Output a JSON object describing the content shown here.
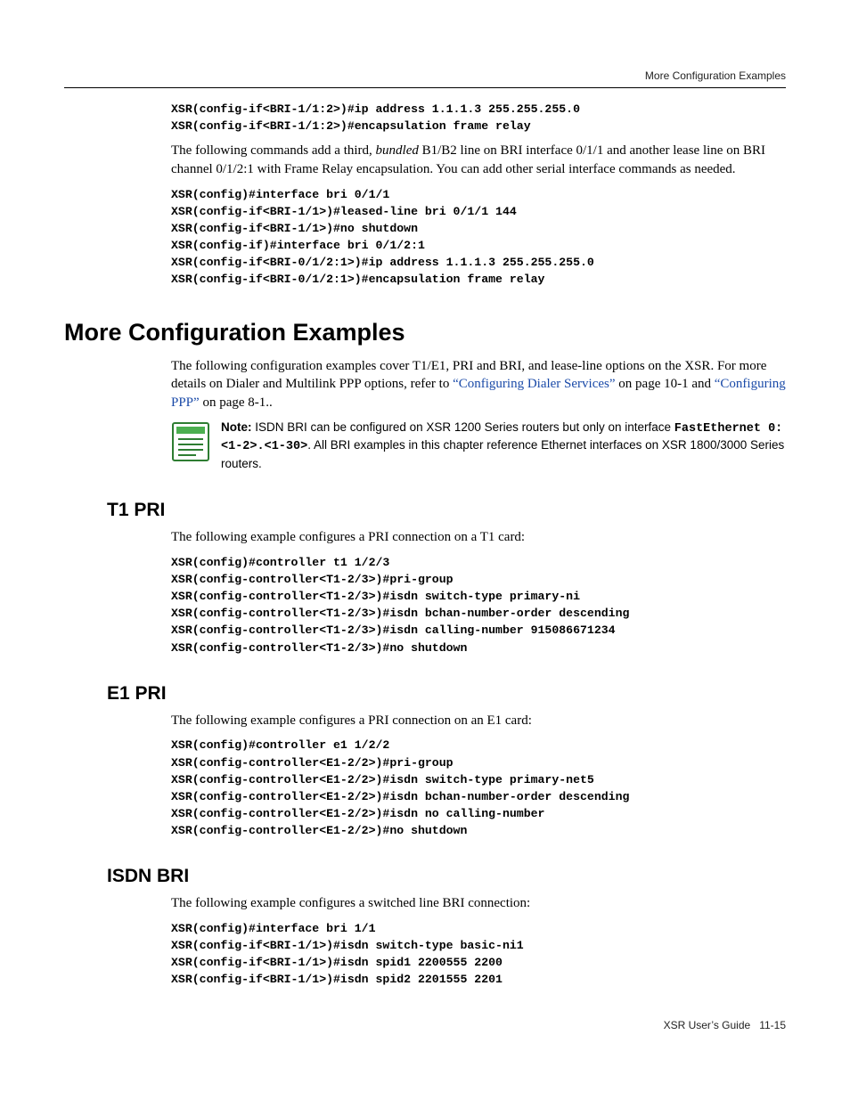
{
  "header": {
    "right": "More Configuration Examples"
  },
  "intro": {
    "code_top": "XSR(config-if<BRI-1/1:2>)#ip address 1.1.1.3 255.255.255.0\nXSR(config-if<BRI-1/1:2>)#encapsulation frame relay",
    "para1_pre": "The following commands add a third, ",
    "para1_italic": "bundled",
    "para1_post": " B1/B2 line on BRI interface 0/1/1 and another lease line on BRI channel 0/1/2:1 with Frame Relay encapsulation. You can add other serial interface commands as needed.",
    "code_block": "XSR(config)#interface bri 0/1/1\nXSR(config-if<BRI-1/1>)#leased-line bri 0/1/1 144\nXSR(config-if<BRI-1/1>)#no shutdown\nXSR(config-if)#interface bri 0/1/2:1\nXSR(config-if<BRI-0/1/2:1>)#ip address 1.1.1.3 255.255.255.0\nXSR(config-if<BRI-0/1/2:1>)#encapsulation frame relay"
  },
  "section_more": {
    "heading": "More Configuration Examples",
    "para_pre": "The following configuration examples cover T1/E1, PRI and BRI, and lease-line options on the XSR. For more details on Dialer and Multilink PPP options, refer to ",
    "link1": "“Configuring Dialer Services”",
    "para_mid": " on page 10-1 and ",
    "link2": "“Configuring PPP”",
    "para_post": " on page 8-1..",
    "note_label": "Note:",
    "note_text1": " ISDN BRI can be configured on XSR 1200 Series routers but only on interface ",
    "note_mono": "FastEthernet 0:<1-2>.<1-30>",
    "note_text2": ". All BRI examples in this chapter reference Ethernet interfaces on XSR 1800/3000 Series routers."
  },
  "t1pri": {
    "heading": "T1 PRI",
    "para": "The following example configures a PRI connection on a T1 card:",
    "code": "XSR(config)#controller t1 1/2/3\nXSR(config-controller<T1-2/3>)#pri-group\nXSR(config-controller<T1-2/3>)#isdn switch-type primary-ni\nXSR(config-controller<T1-2/3>)#isdn bchan-number-order descending\nXSR(config-controller<T1-2/3>)#isdn calling-number 915086671234\nXSR(config-controller<T1-2/3>)#no shutdown"
  },
  "e1pri": {
    "heading": "E1 PRI",
    "para": "The following example configures a PRI connection on an E1 card:",
    "code": "XSR(config)#controller e1 1/2/2\nXSR(config-controller<E1-2/2>)#pri-group\nXSR(config-controller<E1-2/2>)#isdn switch-type primary-net5\nXSR(config-controller<E1-2/2>)#isdn bchan-number-order descending\nXSR(config-controller<E1-2/2>)#isdn no calling-number\nXSR(config-controller<E1-2/2>)#no shutdown"
  },
  "isdnbri": {
    "heading": "ISDN BRI",
    "para": "The following example configures a switched line BRI connection:",
    "code": "XSR(config)#interface bri 1/1\nXSR(config-if<BRI-1/1>)#isdn switch-type basic-ni1\nXSR(config-if<BRI-1/1>)#isdn spid1 2200555 2200\nXSR(config-if<BRI-1/1>)#isdn spid2 2201555 2201"
  },
  "footer": {
    "guide": "XSR User’s Guide",
    "pagenum": "11-15"
  }
}
